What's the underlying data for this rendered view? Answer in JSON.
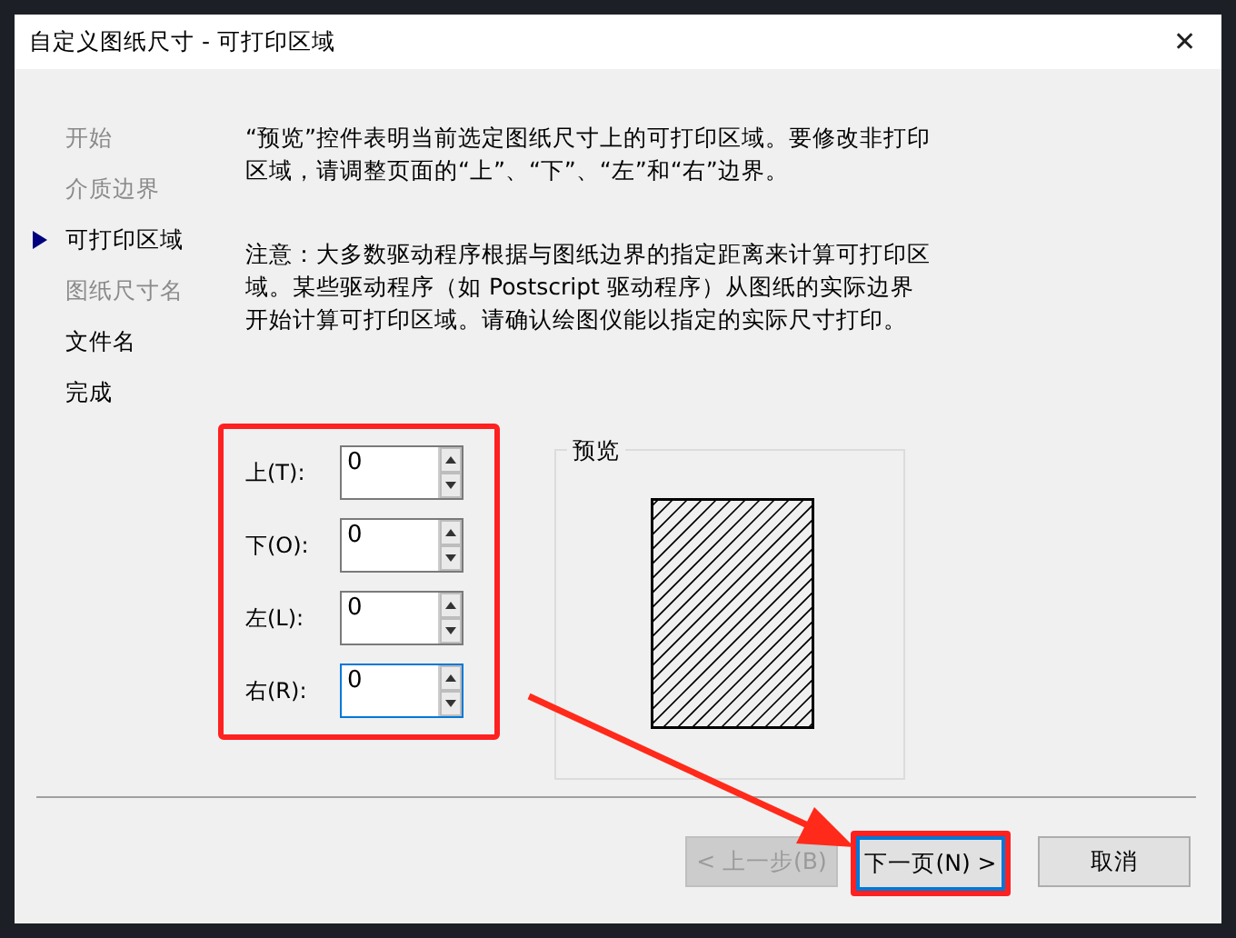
{
  "window": {
    "title": "自定义图纸尺寸 - 可打印区域",
    "close": "✕"
  },
  "steps": [
    {
      "label": "开始",
      "disabled": true,
      "current": false
    },
    {
      "label": "介质边界",
      "disabled": true,
      "current": false
    },
    {
      "label": "可打印区域",
      "disabled": false,
      "current": true
    },
    {
      "label": "图纸尺寸名",
      "disabled": true,
      "current": false
    },
    {
      "label": "文件名",
      "disabled": false,
      "current": false
    },
    {
      "label": "完成",
      "disabled": false,
      "current": false
    }
  ],
  "paragraphs": [
    "“预览”控件表明当前选定图纸尺寸上的可打印区域。要修改非打印区域，请调整页面的“上”、“下”、“左”和“右”边界。",
    "注意：大多数驱动程序根据与图纸边界的指定距离来计算可打印区域。某些驱动程序（如 Postscript 驱动程序）从图纸的实际边界开始计算可打印区域。请确认绘图仪能以指定的实际尺寸打印。"
  ],
  "margins": {
    "highlighted": true,
    "fields": [
      {
        "label": "上(T):",
        "value": "0",
        "focused": false
      },
      {
        "label": "下(O):",
        "value": "0",
        "focused": false
      },
      {
        "label": "左(L):",
        "value": "0",
        "focused": false
      },
      {
        "label": "右(R):",
        "value": "0",
        "focused": true
      }
    ]
  },
  "preview": {
    "title": "预览"
  },
  "buttons": [
    {
      "label": "< 上一步(B)",
      "disabled": true,
      "default": false,
      "highlighted": false
    },
    {
      "label": "下一页(N) >",
      "disabled": false,
      "default": true,
      "highlighted": true
    },
    {
      "label": "取消",
      "disabled": false,
      "default": false,
      "highlighted": false
    }
  ],
  "annotation_arrow": true
}
